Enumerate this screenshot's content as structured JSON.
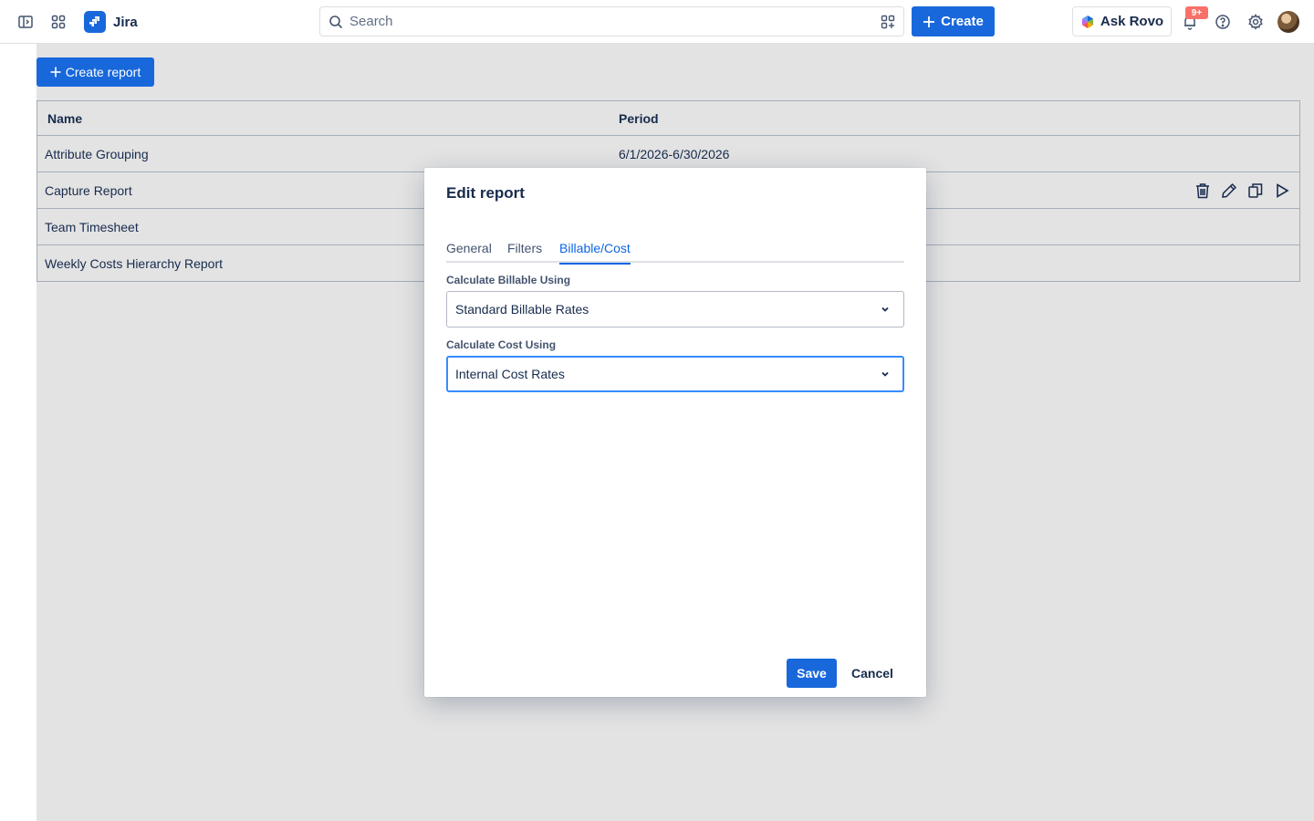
{
  "topbar": {
    "app_name": "Jira",
    "search_placeholder": "Search",
    "create_label": "Create",
    "ask_rovo_label": "Ask Rovo",
    "notification_badge": "9+",
    "brand_color": "#1868db"
  },
  "page": {
    "create_report_label": "Create report",
    "table": {
      "columns": [
        "Name",
        "Period"
      ],
      "rows": [
        {
          "name": "Attribute Grouping",
          "period": "6/1/2026-6/30/2026"
        },
        {
          "name": "Capture Report",
          "period": ""
        },
        {
          "name": "Team Timesheet",
          "period": ""
        },
        {
          "name": "Weekly Costs Hierarchy Report",
          "period": ""
        }
      ]
    },
    "row_action_icons": [
      "trash-icon",
      "pencil-icon",
      "copy-icon",
      "play-icon"
    ]
  },
  "modal": {
    "title": "Edit report",
    "tabs": [
      "General",
      "Filters",
      "Billable/Cost"
    ],
    "active_tab": "Billable/Cost",
    "billable_label": "Calculate Billable Using",
    "billable_value": "Standard Billable Rates",
    "cost_label": "Calculate Cost Using",
    "cost_value": "Internal Cost Rates",
    "save_label": "Save",
    "cancel_label": "Cancel"
  }
}
